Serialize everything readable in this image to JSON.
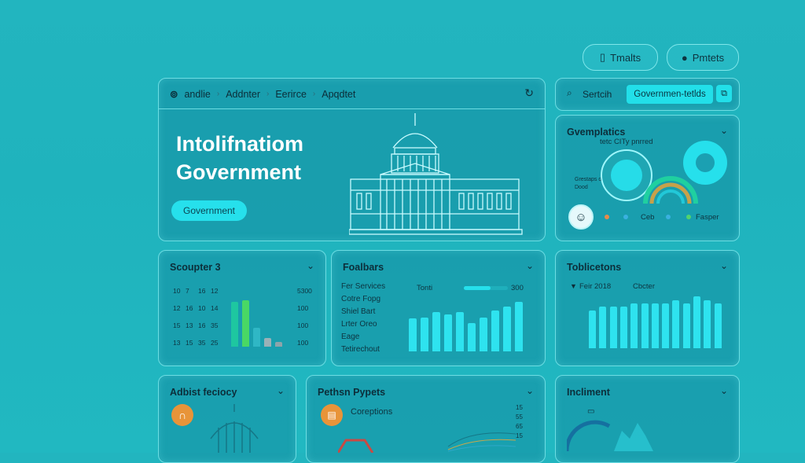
{
  "topbar": {
    "btn1": "Tmalts",
    "btn2": "Pmtets"
  },
  "hero": {
    "nav": [
      "andlie",
      "Addnter",
      "Eerirce",
      "Apqdtet"
    ],
    "title1": "Intolifnatiom",
    "title2": "Government",
    "cta": "Government"
  },
  "search": {
    "label": "Sertcih",
    "button": "Governmen-tetlds"
  },
  "gov": {
    "title": "Gvemplatics",
    "sub": "tetc CITy pnrred",
    "legend": [
      "Ceb",
      "Fasper"
    ],
    "micro": [
      "Grestaps de",
      "Dood"
    ]
  },
  "scouper": {
    "title": "Scoupter 3",
    "left": [
      "10",
      "7",
      "16",
      "12",
      "12",
      "16",
      "10",
      "14",
      "15",
      "13",
      "16",
      "35",
      "13",
      "15",
      "35",
      "25"
    ],
    "right": [
      "5300",
      "100",
      "100",
      "100"
    ],
    "bars": [
      {
        "value": 60,
        "color": "#1ec7a0"
      },
      {
        "value": 62,
        "color": "#49d865"
      },
      {
        "value": 25,
        "color": "#2fb7c5"
      },
      {
        "value": 12,
        "color": "#9ab1b7"
      },
      {
        "value": 6,
        "color": "#8ea4aa"
      }
    ]
  },
  "foalbars": {
    "title": "Foalbars",
    "items": [
      "Fer Services",
      "Cotre Fopg",
      "Shiel Bart",
      "Lrter Oreo",
      "Eage",
      "Tetirechout"
    ],
    "progress_label": "Tonti",
    "progress_value": "300",
    "progress": 0.6,
    "values": [
      58,
      60,
      70,
      65,
      70,
      50,
      60,
      72,
      80,
      88
    ]
  },
  "tobli": {
    "title": "Toblicetons",
    "legend1": "Feir 2018",
    "legend2": "Cbcter",
    "values": [
      55,
      60,
      60,
      60,
      65,
      65,
      65,
      65,
      70,
      65,
      75,
      70,
      65
    ]
  },
  "bottom": {
    "b1": "Adbist feciocy",
    "b2": "Pethsn Pypets",
    "b2_sub": "Coreptions",
    "b2_right": [
      "15",
      "55",
      "65",
      "15"
    ],
    "b3": "Incliment"
  },
  "colors": {
    "accent": "#26e0ec",
    "bg": "#21b6bf"
  }
}
